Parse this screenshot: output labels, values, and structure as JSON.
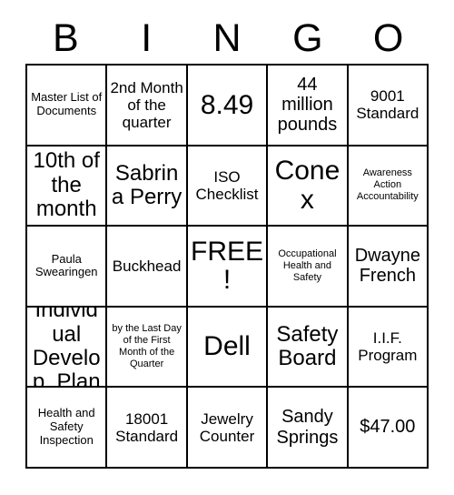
{
  "card": {
    "type": "bingo-card",
    "columns": 5,
    "rows": 5,
    "header": [
      "B",
      "I",
      "N",
      "G",
      "O"
    ],
    "free_space": {
      "row": 3,
      "column": 3,
      "label": "FREE!"
    },
    "colors": {
      "background": "#ffffff",
      "border": "#000000",
      "text": "#000000"
    },
    "grid": [
      [
        {
          "text": "Master List of Documents",
          "size": "sm"
        },
        {
          "text": "2nd Month of the quarter",
          "size": "md"
        },
        {
          "text": "8.49",
          "size": "xxl"
        },
        {
          "text": "44 million pounds",
          "size": "lg"
        },
        {
          "text": "9001 Standard",
          "size": "md"
        }
      ],
      [
        {
          "text": "10th of the month",
          "size": "xl"
        },
        {
          "text": "Sabrina Perry",
          "size": "xl"
        },
        {
          "text": "ISO Checklist",
          "size": "md"
        },
        {
          "text": "Conex",
          "size": "xxl"
        },
        {
          "text": "Awareness Action Accountability",
          "size": "xs"
        }
      ],
      [
        {
          "text": "Paula Swearingen",
          "size": "sm"
        },
        {
          "text": "Buckhead",
          "size": "md"
        },
        {
          "text": "FREE!",
          "size": "xxl"
        },
        {
          "text": "Occupational Health and Safety",
          "size": "xs"
        },
        {
          "text": "Dwayne French",
          "size": "lg"
        }
      ],
      [
        {
          "text": "Individual Develop. Plan",
          "size": "xl"
        },
        {
          "text": "by the Last Day of the First Month of the Quarter",
          "size": "xs"
        },
        {
          "text": "Dell",
          "size": "xxl"
        },
        {
          "text": "Safety Board",
          "size": "xl"
        },
        {
          "text": "I.I.F. Program",
          "size": "md"
        }
      ],
      [
        {
          "text": "Health and Safety Inspection",
          "size": "sm"
        },
        {
          "text": "18001 Standard",
          "size": "md"
        },
        {
          "text": "Jewelry Counter",
          "size": "md"
        },
        {
          "text": "Sandy Springs",
          "size": "lg"
        },
        {
          "text": "$47.00",
          "size": "lg"
        }
      ]
    ]
  }
}
